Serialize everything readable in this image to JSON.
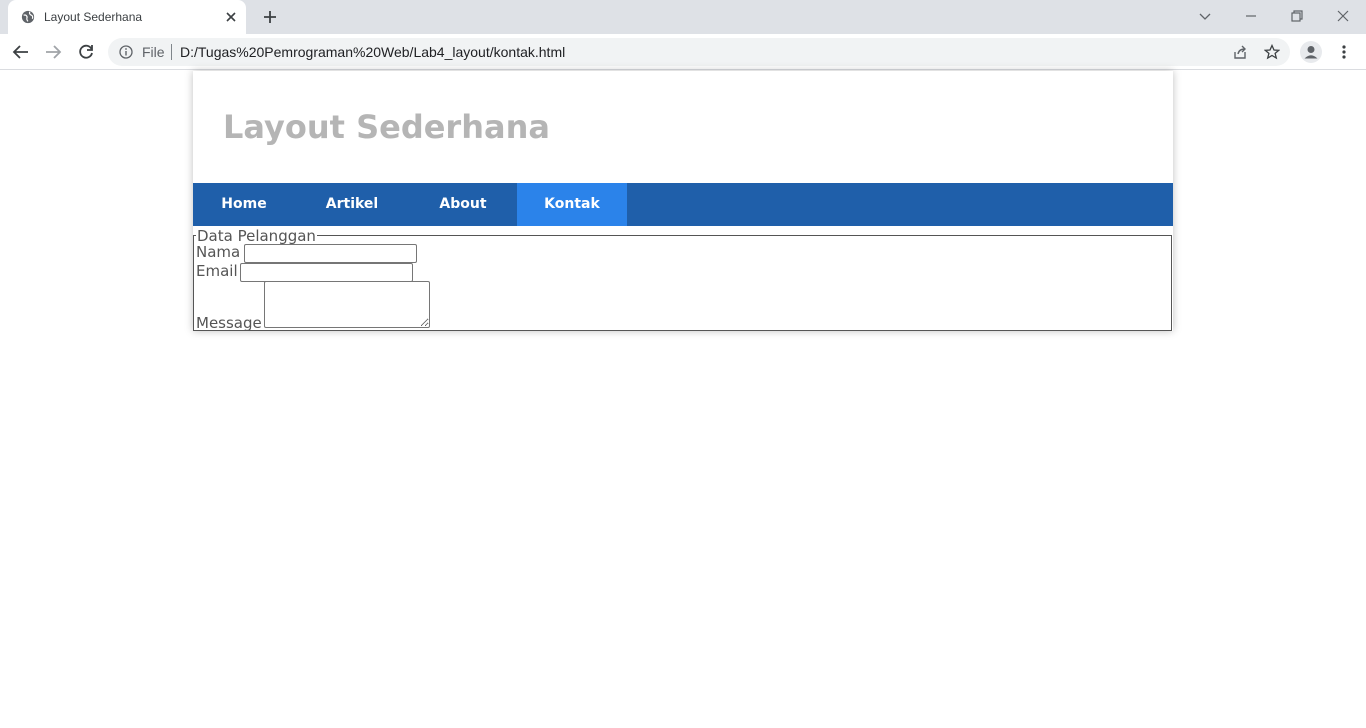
{
  "browser": {
    "tab_title": "Layout Sederhana",
    "file_label": "File",
    "url": "D:/Tugas%20Pemrograman%20Web/Lab4_layout/kontak.html"
  },
  "page": {
    "title": "Layout Sederhana",
    "nav": [
      {
        "label": "Home",
        "active": false
      },
      {
        "label": "Artikel",
        "active": false
      },
      {
        "label": "About",
        "active": false
      },
      {
        "label": "Kontak",
        "active": true
      }
    ],
    "form": {
      "legend": "Data Pelanggan",
      "nama_label": "Nama",
      "email_label": "Email",
      "message_label": "Message",
      "nama_value": "",
      "email_value": "",
      "message_value": ""
    }
  },
  "colors": {
    "nav_bg": "#1f5faa",
    "nav_active_bg": "#2b83ea",
    "title_text": "#b5b5b5"
  }
}
